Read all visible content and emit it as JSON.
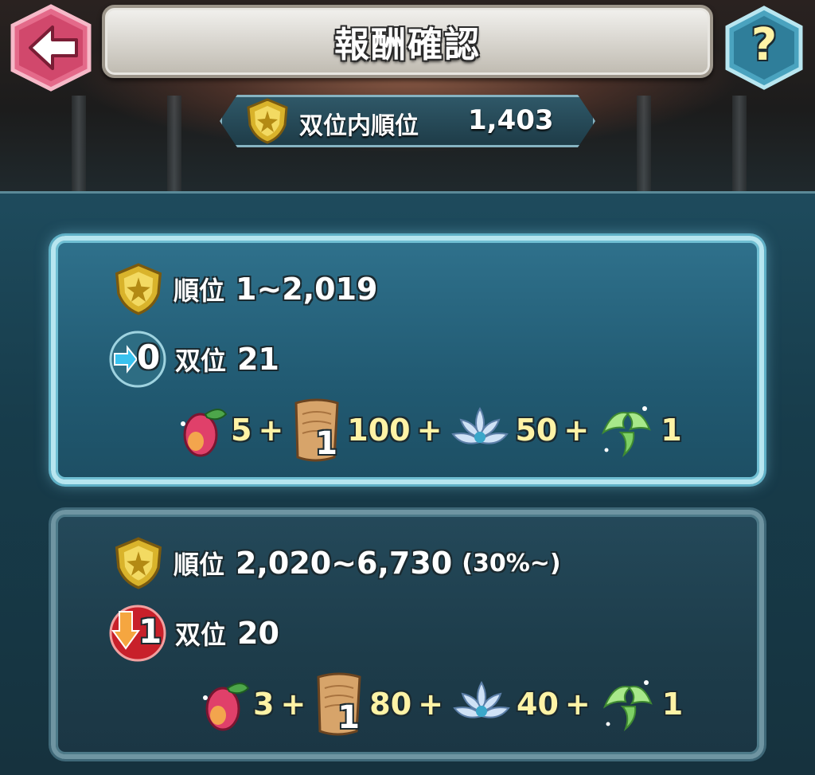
{
  "header": {
    "title": "報酬確認",
    "back_icon": "back-arrow-icon",
    "help_icon": "help-question-icon",
    "help_glyph": "?"
  },
  "rank": {
    "label": "双位内順位",
    "value": "1,403",
    "icon": "gold-crest-icon"
  },
  "tiers": [
    {
      "rank_label": "順位",
      "rank_range": "1~2,019",
      "rank_note": "",
      "tier_badge_value": "0",
      "tier_badge_icon": "tier-keep-arrow-icon",
      "tier_label": "双位",
      "tier_value": "21",
      "rewards": [
        {
          "icon": "orb-fruit-icon",
          "amount": "5",
          "sep": "+"
        },
        {
          "icon": "scroll-icon",
          "badge": "1",
          "amount": "100",
          "sep": "+"
        },
        {
          "icon": "lotus-flower-icon",
          "amount": "50",
          "sep": "+"
        },
        {
          "icon": "green-feather-icon",
          "amount": "1",
          "sep": ""
        }
      ]
    },
    {
      "rank_label": "順位",
      "rank_range": "2,020~6,730",
      "rank_note": "(30%~)",
      "tier_badge_value": "1",
      "tier_badge_icon": "tier-down-arrow-icon",
      "tier_label": "双位",
      "tier_value": "20",
      "rewards": [
        {
          "icon": "orb-fruit-icon",
          "amount": "3",
          "sep": "+"
        },
        {
          "icon": "scroll-icon",
          "badge": "1",
          "amount": "80",
          "sep": "+"
        },
        {
          "icon": "lotus-flower-icon",
          "amount": "40",
          "sep": "+"
        },
        {
          "icon": "green-feather-icon",
          "amount": "1",
          "sep": ""
        }
      ]
    }
  ]
}
